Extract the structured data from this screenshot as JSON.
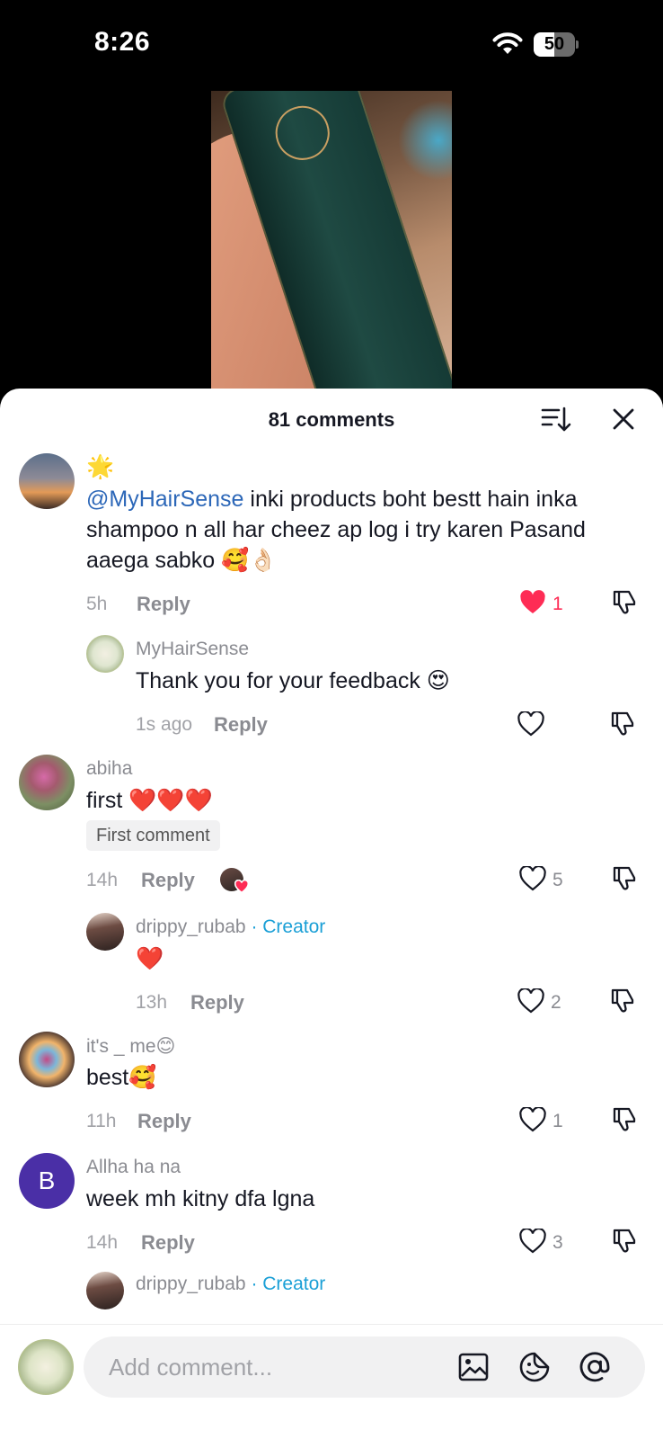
{
  "status_bar": {
    "time": "8:26",
    "battery": "50"
  },
  "sheet": {
    "title": "81 comments"
  },
  "comments": [
    {
      "emoji": "🌟",
      "mention": "@MyHairSense",
      "text": " inki products boht bestt hain inka shampoo n all har cheez ap log i try karen Pasand aaega sabko 🥰👌🏻",
      "time": "5h",
      "reply_label": "Reply",
      "likes": "1",
      "liked": true,
      "replies": [
        {
          "username": "MyHairSense",
          "text": "Thank you for your feedback 😍",
          "time": "1s ago",
          "reply_label": "Reply",
          "likes": ""
        }
      ]
    },
    {
      "username": "abiha",
      "text": "first ❤️❤️❤️",
      "badge": "First comment",
      "time": "14h",
      "reply_label": "Reply",
      "likes": "5",
      "replies": [
        {
          "username": "drippy_rubab",
          "creator_label": "· Creator",
          "text": "❤️",
          "time": "13h",
          "reply_label": "Reply",
          "likes": "2"
        }
      ]
    },
    {
      "username": "it's _ me😊",
      "text": "best🥰",
      "time": "11h",
      "reply_label": "Reply",
      "likes": "1"
    },
    {
      "username": "Allha ha na",
      "avatar_letter": "B",
      "text": "week mh kitny dfa lgna",
      "time": "14h",
      "reply_label": "Reply",
      "likes": "3",
      "replies": [
        {
          "username": "drippy_rubab",
          "creator_label": "· Creator"
        }
      ]
    }
  ],
  "composer": {
    "placeholder": "Add comment..."
  },
  "colors": {
    "accent_red": "#fe2c55",
    "creator_blue": "#1a9fd6",
    "mention_blue": "#2c67b8",
    "avatar_purple": "#4a2fa6"
  },
  "icons": [
    "wifi-icon",
    "battery-icon",
    "sort-icon",
    "close-icon",
    "heart-icon",
    "dislike-icon",
    "image-icon",
    "emoji-icon",
    "at-icon"
  ]
}
